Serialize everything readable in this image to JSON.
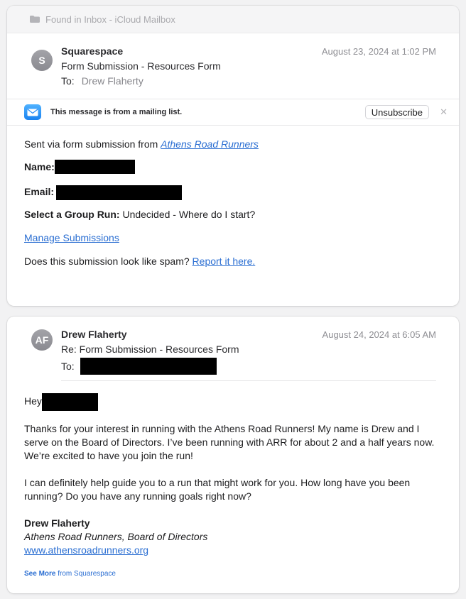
{
  "mailbox_bar": {
    "label": "Found in Inbox - iCloud Mailbox"
  },
  "message1": {
    "avatar_initial": "S",
    "sender": "Squarespace",
    "subject": "Form Submission - Resources Form",
    "to_label": "To:",
    "to_name": "Drew Flaherty",
    "date": "August 23, 2024 at 1:02 PM",
    "mailing_list_notice": "This message is from a mailing list.",
    "unsubscribe_label": "Unsubscribe",
    "close_glyph": "✕",
    "intro_text": "Sent via form submission from ",
    "intro_link": "Athens Road Runners",
    "name_label": "Name:",
    "email_label": "Email:",
    "group_run_label": "Select a Group Run:",
    "group_run_value": " Undecided - Where do I start?",
    "manage_link": "Manage Submissions",
    "spam_question": "Does this submission look like spam? ",
    "spam_link": "Report it here."
  },
  "message2": {
    "avatar_initials": "AF",
    "sender": "Drew Flaherty",
    "subject": "Re: Form Submission - Resources Form",
    "to_label": "To:",
    "date": "August 24, 2024 at 6:05 AM",
    "greeting": "Hey",
    "para1_line1": "Thanks for your interest in running with the Athens Road Runners! My name is Drew and I",
    "para1_line2": "serve on the Board of Directors. I’ve been running with ARR for about 2 and a half years now.",
    "para1_line3": "We’re excited to have you join the run!",
    "para2_line1": "I can definitely help guide you to a run that might work for you. How long have you been",
    "para2_line2": "running? Do you have any running goals right now?",
    "signature_name": "Drew Flaherty",
    "signature_title": "Athens Road Runners, Board of Directors",
    "signature_link": "www.athensroadrunners.org",
    "see_more_bold": "See More",
    "see_more_rest": " from Squarespace"
  },
  "colors": {
    "link": "#2a6ed2",
    "avatar": "#9a9a9f",
    "mail_icon": "#1a82f0"
  }
}
